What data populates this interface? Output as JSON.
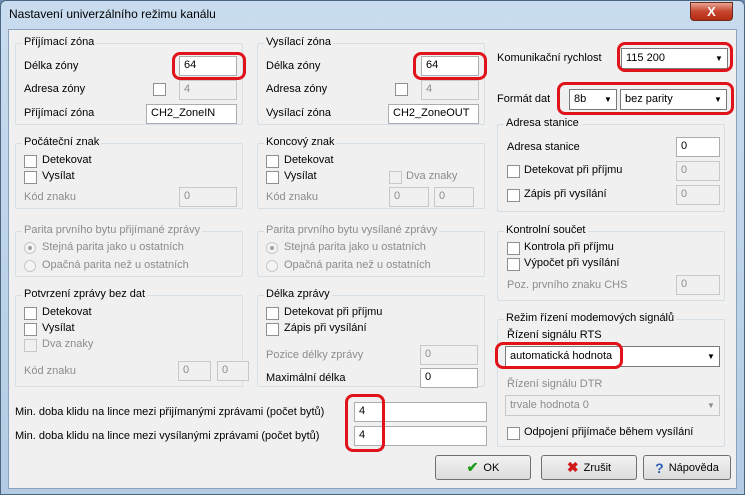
{
  "window": {
    "title": "Nastavení univerzálního režimu kanálu",
    "close": "X"
  },
  "rx_zone": {
    "title": "Příjímací zóna",
    "length_label": "Délka zóny",
    "length_value": "64",
    "address_label": "Adresa zóny",
    "address_value": "4",
    "name_label": "Příjímací zóna",
    "name_value": "CH2_ZoneIN"
  },
  "tx_zone": {
    "title": "Vysílací zóna",
    "length_label": "Délka zóny",
    "length_value": "64",
    "address_label": "Adresa zóny",
    "address_value": "4",
    "name_label": "Vysílací zóna",
    "name_value": "CH2_ZoneOUT"
  },
  "comm": {
    "speed_label": "Komunikační rychlost",
    "speed_value": "115 200",
    "format_label": "Formát dat",
    "bits_value": "8b",
    "parity_value": "bez parity"
  },
  "station": {
    "title": "Adresa stanice",
    "address_label": "Adresa stanice",
    "address_value": "0",
    "detect_label": "Detekovat při příjmu",
    "detect_value": "0",
    "write_label": "Zápis při vysílání",
    "write_value": "0"
  },
  "start_char": {
    "title": "Počáteční znak",
    "detect_label": "Detekovat",
    "send_label": "Vysílat",
    "code_label": "Kód znaku",
    "code_value": "0"
  },
  "end_char": {
    "title": "Koncový znak",
    "detect_label": "Detekovat",
    "send_label": "Vysílat",
    "two_label": "Dva znaky",
    "code_label": "Kód znaku",
    "code1_value": "0",
    "code2_value": "0"
  },
  "checksum": {
    "title": "Kontrolní součet",
    "check_label": "Kontrola při příjmu",
    "calc_label": "Výpočet při vysílání",
    "pos_label": "Poz. prvního znaku CHS",
    "pos_value": "0"
  },
  "rx_parity": {
    "title": "Parita prvního bytu přijímané zprávy",
    "same_label": "Stejná parita jako u ostatních",
    "opp_label": "Opačná parita než u ostatních"
  },
  "tx_parity": {
    "title": "Parita prvního bytu vysílané zprávy",
    "same_label": "Stejná parita jako u ostatních",
    "opp_label": "Opačná parita než u ostatních"
  },
  "ack": {
    "title": "Potvrzení zprávy bez dat",
    "detect_label": "Detekovat",
    "send_label": "Vysílat",
    "two_label": "Dva znaky",
    "code_label": "Kód znaku",
    "code1_value": "0",
    "code2_value": "0"
  },
  "msg_len": {
    "title": "Délka zprávy",
    "detect_label": "Detekovat při příjmu",
    "write_label": "Zápis při vysílání",
    "pos_label": "Pozice délky zprávy",
    "pos_value": "0",
    "max_label": "Maximální délka",
    "max_value": "0"
  },
  "modem": {
    "title": "Režim řízení modemových signálů",
    "rts_label": "Řízení signálu RTS",
    "rts_value": "automatická hodnota",
    "dtr_label": "Řízení signálu DTR",
    "dtr_value": "trvale hodnota 0",
    "disconnect_label": "Odpojení přijímače během vysílání"
  },
  "idle": {
    "rx_label": "Min. doba klidu na lince mezi přijímanými zprávami (počet bytů)",
    "rx_value": "4",
    "tx_label": "Min. doba klidu na lince mezi vysílanými zprávami (počet bytů)",
    "tx_value": "4"
  },
  "buttons": {
    "ok": "OK",
    "cancel": "Zrušit",
    "help": "Nápověda"
  }
}
